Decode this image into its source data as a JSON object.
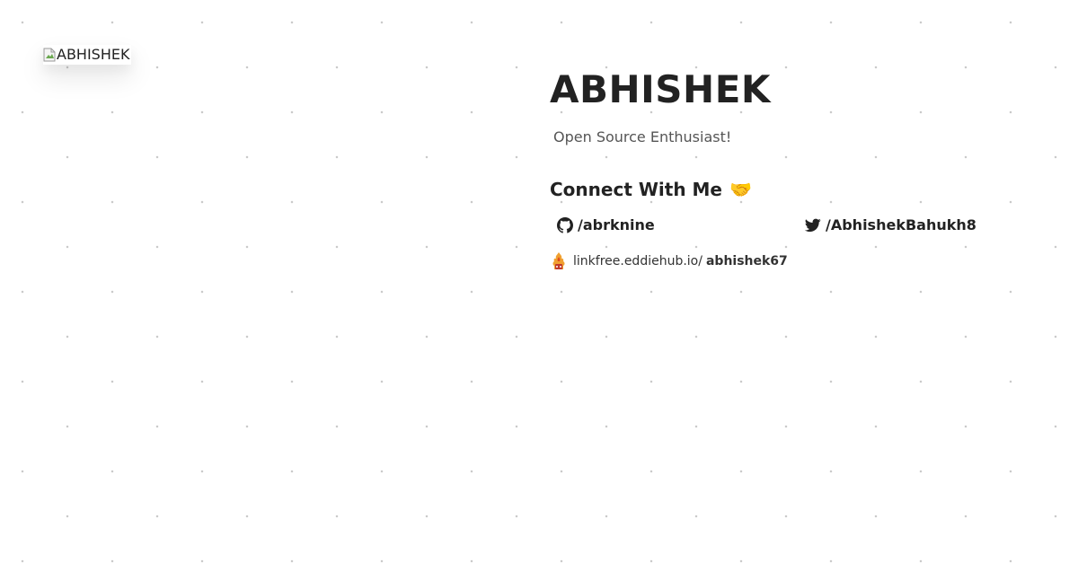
{
  "profile": {
    "avatar_alt": "ABHISHEK",
    "name": "ABHISHEK",
    "tagline": "Open Source Enthusiast!"
  },
  "connect": {
    "heading": "Connect With Me",
    "emoji": "🤝"
  },
  "socials": {
    "github": {
      "label": "/abrknine",
      "icon": "github-icon"
    },
    "twitter": {
      "label": "/AbhishekBahukh8",
      "icon": "twitter-icon"
    }
  },
  "linkfree": {
    "icon": "linkfree-logo-icon",
    "base": "linkfree.eddiehub.io/",
    "handle": "abhishek67"
  },
  "colors": {
    "text": "#222222",
    "muted": "#555555",
    "dots": "#c9c9c9",
    "twitter_icon": "#222222"
  }
}
